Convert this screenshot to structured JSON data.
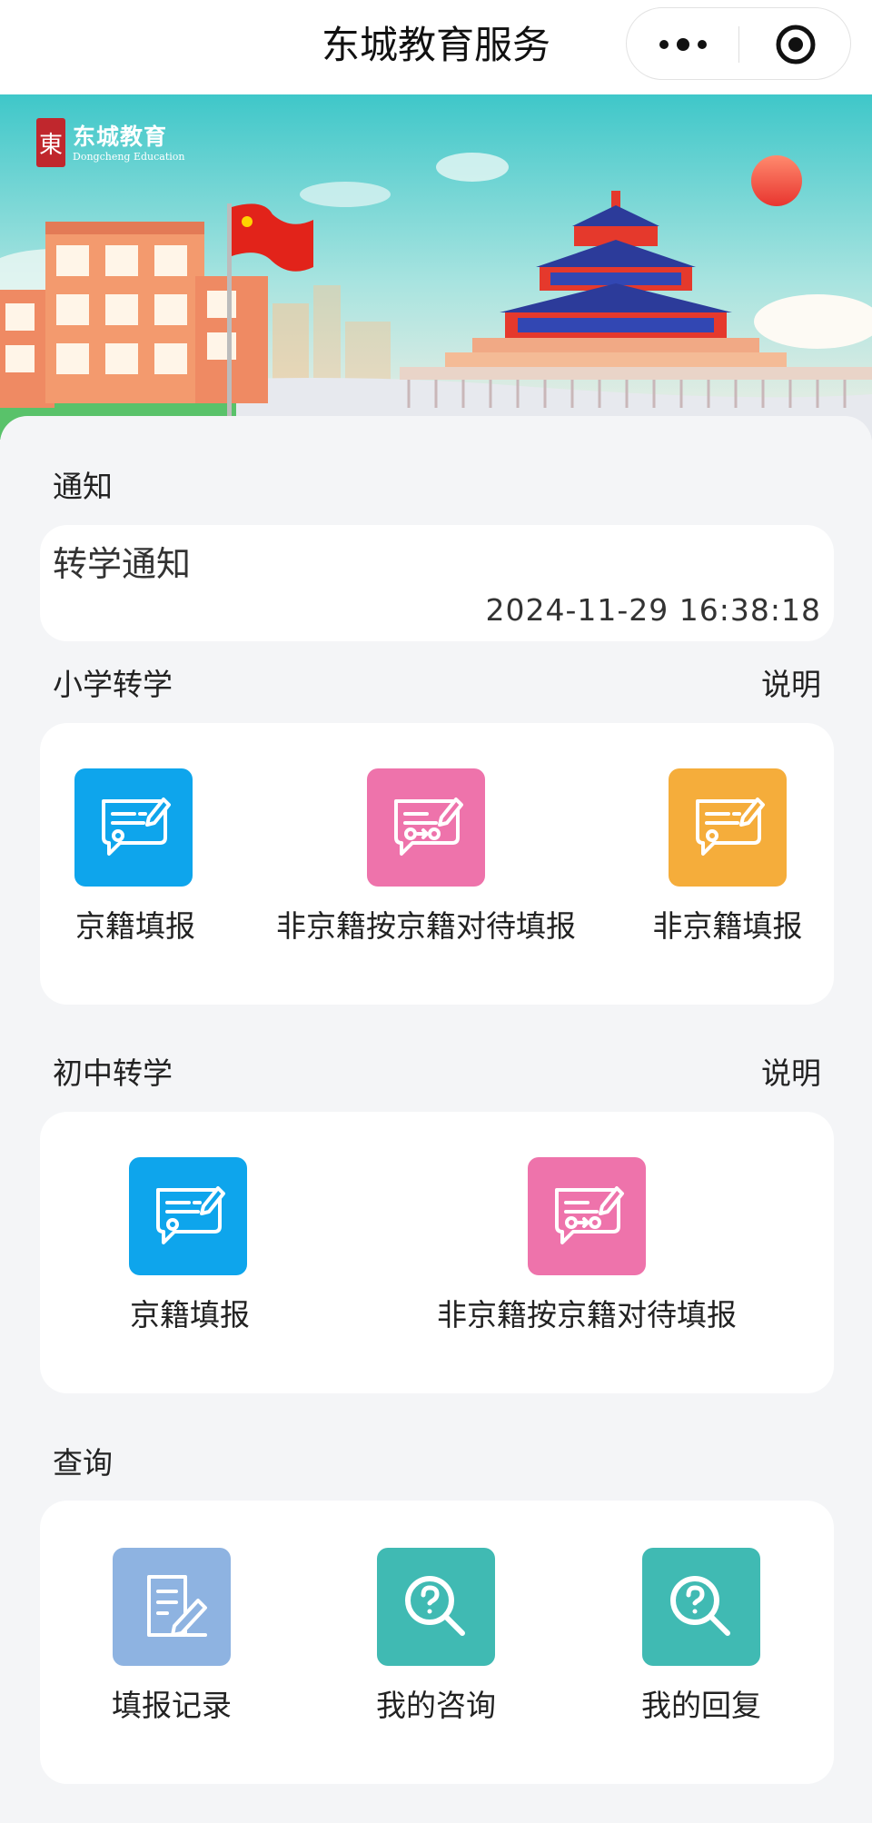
{
  "header": {
    "title": "东城教育服务",
    "more_icon": "more-dots-icon",
    "close_icon": "target-close-icon"
  },
  "banner": {
    "logo_text": "东城教育",
    "logo_en": "Dongcheng Education",
    "logo_seal": "東"
  },
  "notice": {
    "section_title": "通知",
    "item_title": "转学通知",
    "item_time": "2024-11-29 16:38:18"
  },
  "primary": {
    "section_title": "小学转学",
    "help_label": "说明",
    "items": [
      {
        "label": "京籍填报",
        "icon": "form-edit-icon",
        "color": "#0ea5ec"
      },
      {
        "label": "非京籍按京籍对待填报",
        "icon": "form-transfer-icon",
        "color": "#ee73ab"
      },
      {
        "label": "非京籍填报",
        "icon": "form-edit-icon",
        "color": "#f5ad3b"
      }
    ]
  },
  "middle": {
    "section_title": "初中转学",
    "help_label": "说明",
    "items": [
      {
        "label": "京籍填报",
        "icon": "form-edit-icon",
        "color": "#0ea5ec"
      },
      {
        "label": "非京籍按京籍对待填报",
        "icon": "form-transfer-icon",
        "color": "#ee73ab"
      }
    ]
  },
  "query": {
    "section_title": "查询",
    "items": [
      {
        "label": "填报记录",
        "icon": "record-edit-icon",
        "color": "#8eb3e1"
      },
      {
        "label": "我的咨询",
        "icon": "question-search-icon",
        "color": "#40bab3"
      },
      {
        "label": "我的回复",
        "icon": "question-search-icon",
        "color": "#40bab3"
      }
    ]
  }
}
